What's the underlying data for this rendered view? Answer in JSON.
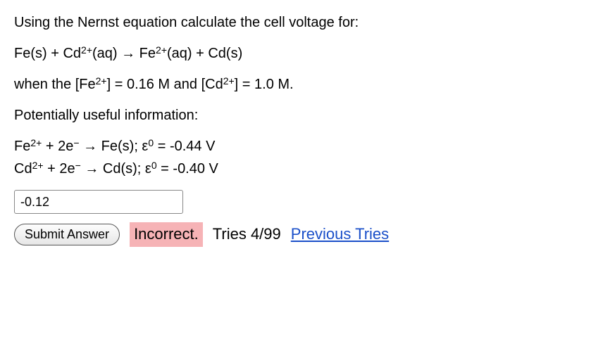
{
  "prompt": {
    "intro": "Using the Nernst equation calculate the cell voltage for:",
    "reaction_p1": "Fe(s) + Cd",
    "reaction_p2": "(aq) → Fe",
    "reaction_p3": "(aq) + Cd(s)",
    "cond_p1": "when the [Fe",
    "cond_p2": "] = 0.16 M and [Cd",
    "cond_p3": "] = 1.0 M.",
    "useful_header": "Potentially useful information:",
    "half1_a": "Fe",
    "half1_b": " + 2e",
    "half1_c": " → Fe(s); ε",
    "half1_d": " = -0.44 V",
    "half2_a": "Cd",
    "half2_b": " + 2e",
    "half2_c": " → Cd(s); ε",
    "half2_d": " = -0.40 V",
    "sup_2plus": "2+",
    "sup_minus": "−",
    "sup_zero": "0"
  },
  "answer": {
    "value": "-0.12"
  },
  "controls": {
    "submit_label": "Submit Answer",
    "status": "Incorrect.",
    "tries_text": "Tries 4/99",
    "prev_tries": "Previous Tries"
  }
}
